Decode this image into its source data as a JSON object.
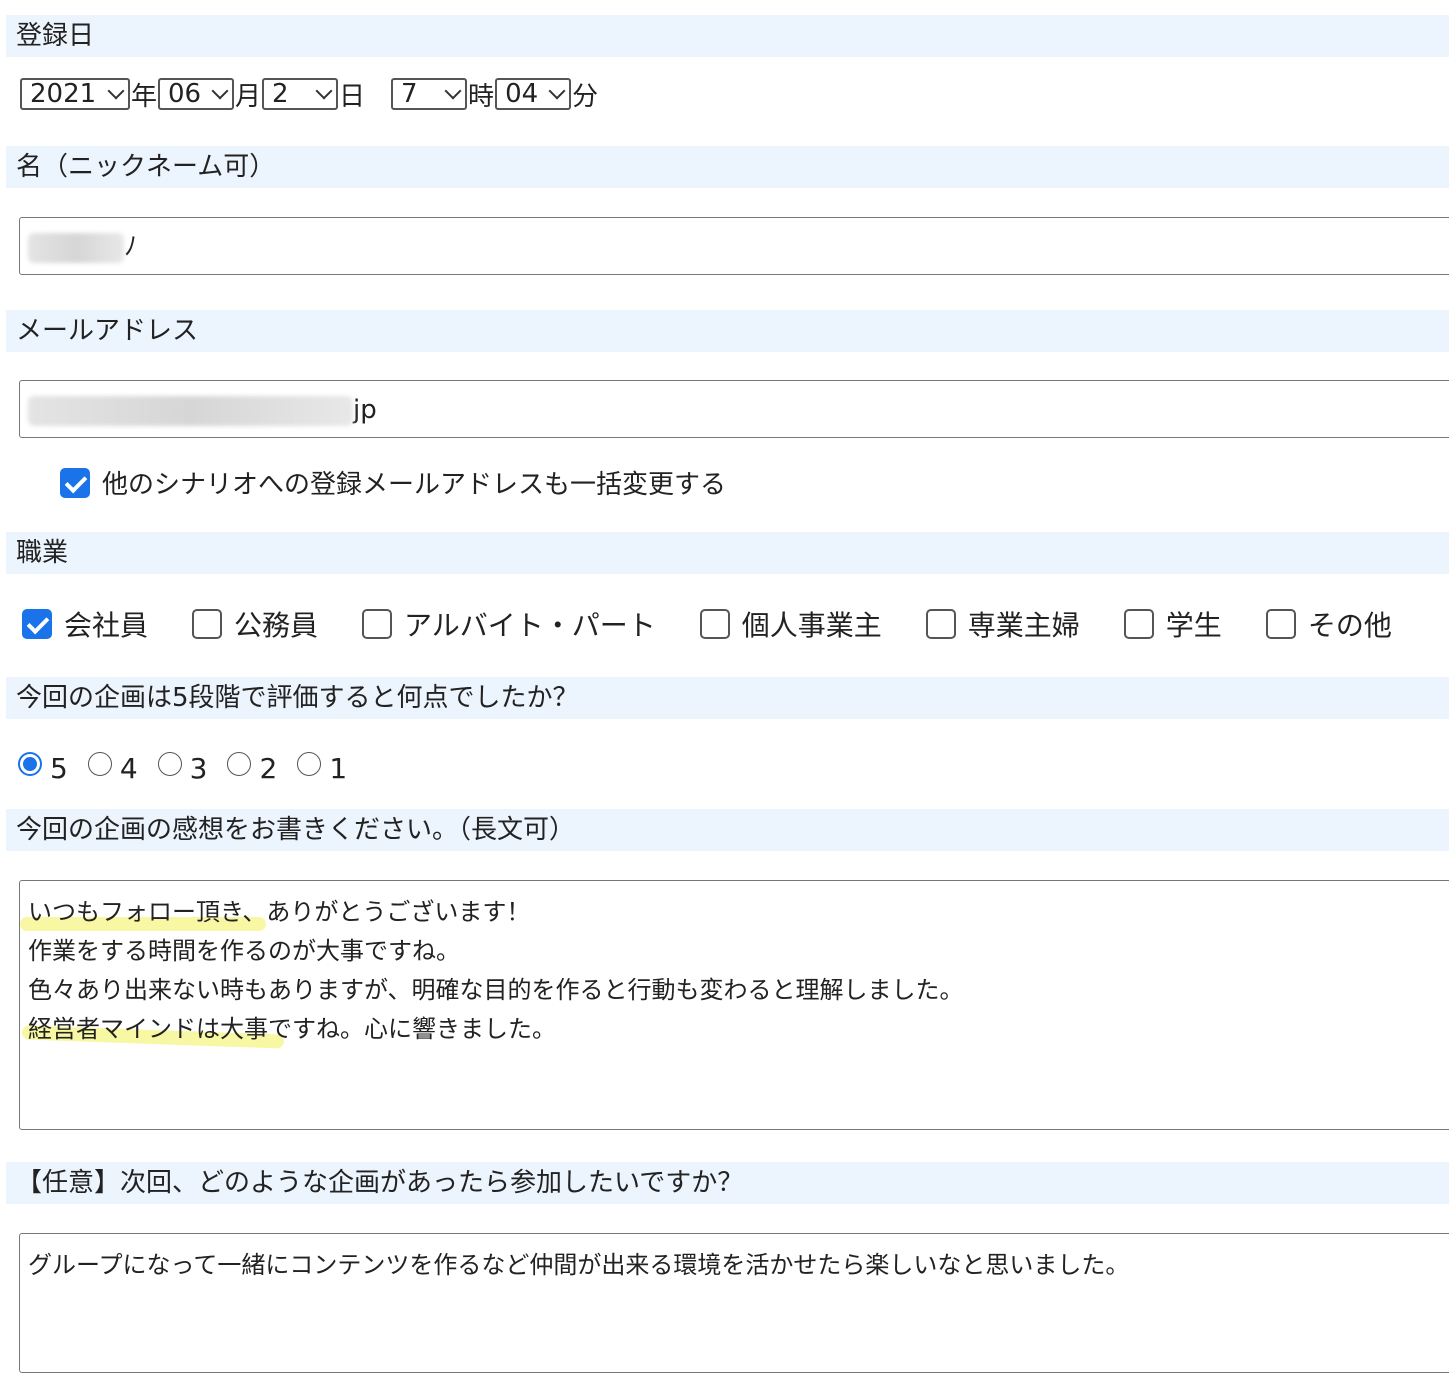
{
  "registration": {
    "label": "登録日",
    "year": "2021",
    "year_unit": "年",
    "month": "06",
    "month_unit": "月",
    "day": "2",
    "day_unit": "日",
    "hour": "7",
    "hour_unit": "時",
    "minute": "04",
    "minute_unit": "分"
  },
  "name": {
    "label": "名（ニックネーム可）",
    "value_suffix": "ﾉ"
  },
  "email": {
    "label": "メールアドレス",
    "value_suffix": "jp",
    "bulk_change_label": "他のシナリオへの登録メールアドレスも一括変更する",
    "bulk_change_checked": true
  },
  "occupation": {
    "label": "職業",
    "options": [
      {
        "label": "会社員",
        "checked": true
      },
      {
        "label": "公務員",
        "checked": false
      },
      {
        "label": "アルバイト・パート",
        "checked": false
      },
      {
        "label": "個人事業主",
        "checked": false
      },
      {
        "label": "専業主婦",
        "checked": false
      },
      {
        "label": "学生",
        "checked": false
      },
      {
        "label": "その他",
        "checked": false
      }
    ]
  },
  "rating": {
    "label": "今回の企画は5段階で評価すると何点でしたか？",
    "options": [
      "5",
      "4",
      "3",
      "2",
      "1"
    ],
    "selected": "5"
  },
  "impressions": {
    "label": "今回の企画の感想をお書きください。（長文可）",
    "lines": [
      "いつもフォロー頂き、ありがとうございます！",
      "作業をする時間を作るのが大事ですね。",
      "色々あり出来ない時もありますが、明確な目的を作ると行動も変わると理解しました。",
      "経営者マインドは大事ですね。心に響きました。"
    ]
  },
  "next_plan": {
    "label": "【任意】次回、どのような企画があったら参加したいですか？",
    "lines": [
      "グループになって一緒にコンテンツを作るなど仲間が出来る環境を活かせたら楽しいなと思いました。"
    ]
  },
  "colors": {
    "label_bg": "#ecf4fd",
    "accent": "#1a73e8",
    "highlight": "#f0f05a"
  }
}
